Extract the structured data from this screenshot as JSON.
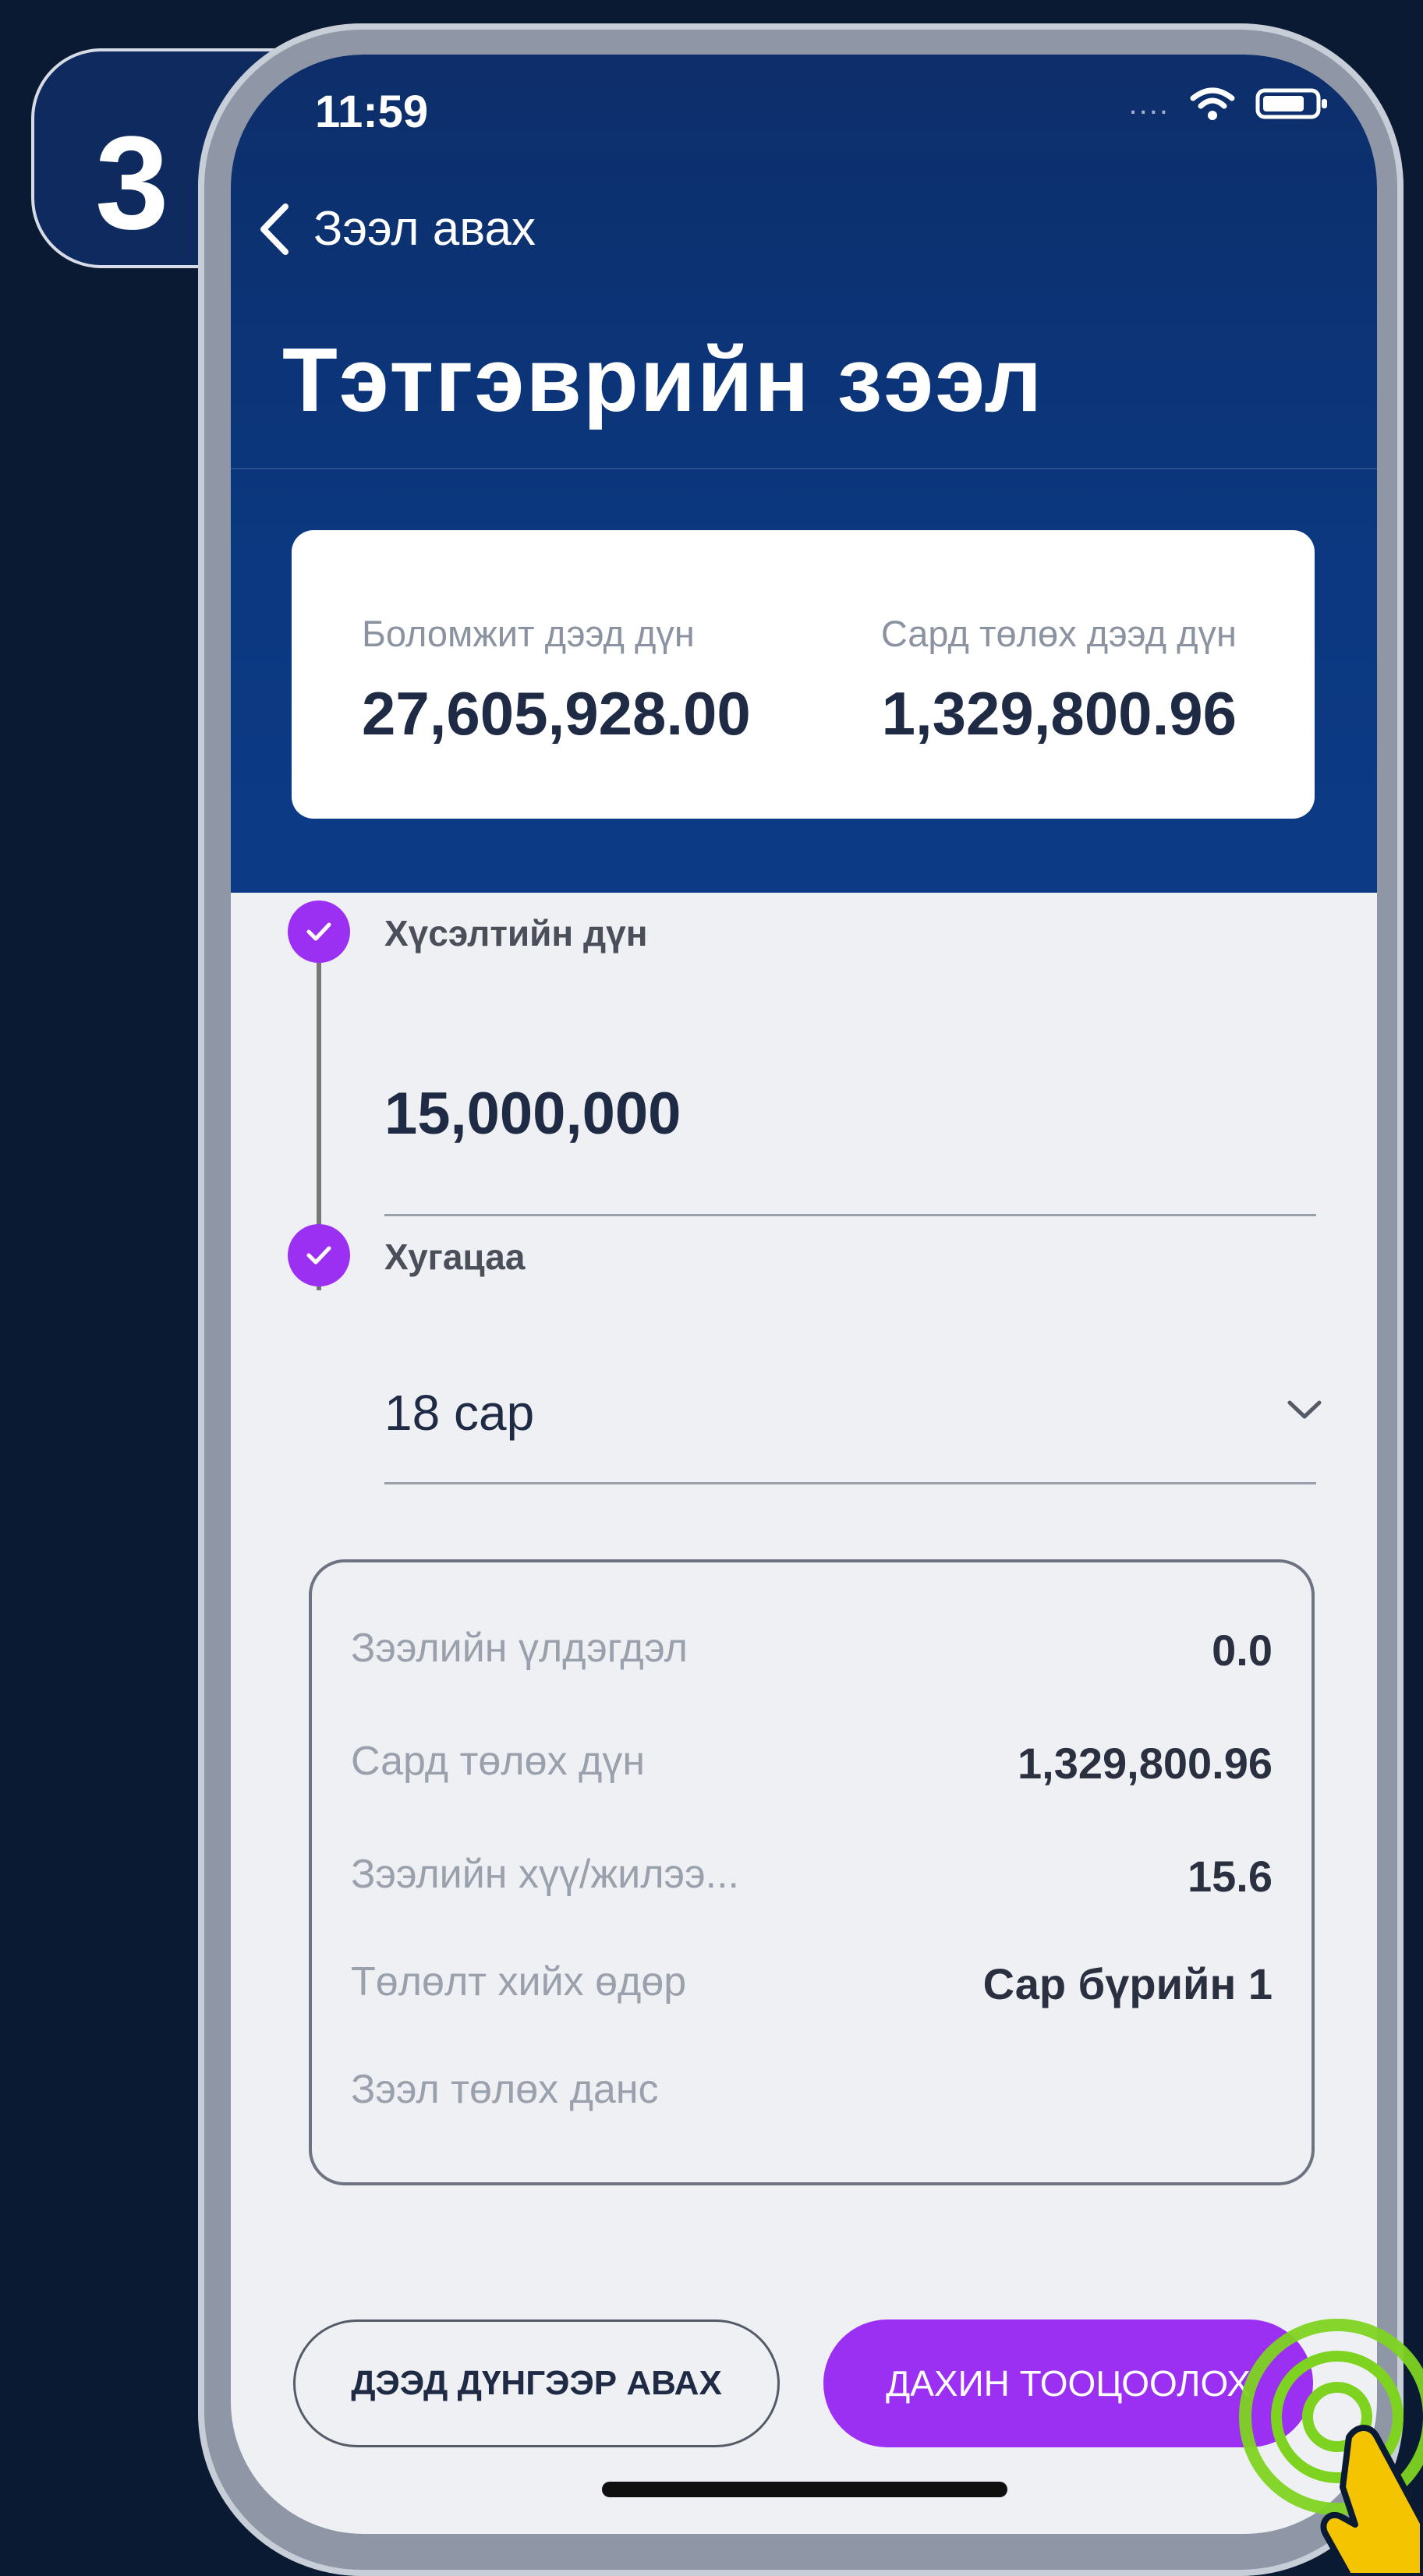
{
  "step": {
    "number": "3"
  },
  "status_bar": {
    "time": "11:59",
    "signal": "....",
    "wifi_icon": "wifi-icon",
    "battery_icon": "battery-icon"
  },
  "nav": {
    "back_label": "Зээл авах"
  },
  "page": {
    "title": "Тэтгэврийн зээл"
  },
  "summary": {
    "max_amount_label": "Боломжит дээд дүн",
    "max_amount_value": "27,605,928.00",
    "monthly_max_label": "Сард төлөх дээд дүн",
    "monthly_max_value": "1,329,800.96"
  },
  "form": {
    "amount_label": "Хүсэлтийн дүн",
    "amount_value": "15,000,000",
    "term_label": "Хугацаа",
    "term_value": "18 сар"
  },
  "details": [
    {
      "label": "Зээлийн үлдэгдэл",
      "value": "0.0"
    },
    {
      "label": "Сард төлөх дүн",
      "value": "1,329,800.96"
    },
    {
      "label": "Зээлийн хүү/жилээ...",
      "value": "15.6"
    },
    {
      "label": "Төлөлт хийх өдөр",
      "value": "Сар бүрийн 1"
    },
    {
      "label": "Зээл төлөх данс",
      "value": ""
    }
  ],
  "actions": {
    "max_button": "ДЭЭД ДҮНГЭЭР АВАХ",
    "recalc_button": "ДАХИН ТООЦООЛОХ"
  },
  "colors": {
    "header_blue": "#0c3a85",
    "accent_purple": "#9b30f2",
    "tap_green": "#7ed321",
    "hand_yellow": "#f5c400"
  }
}
